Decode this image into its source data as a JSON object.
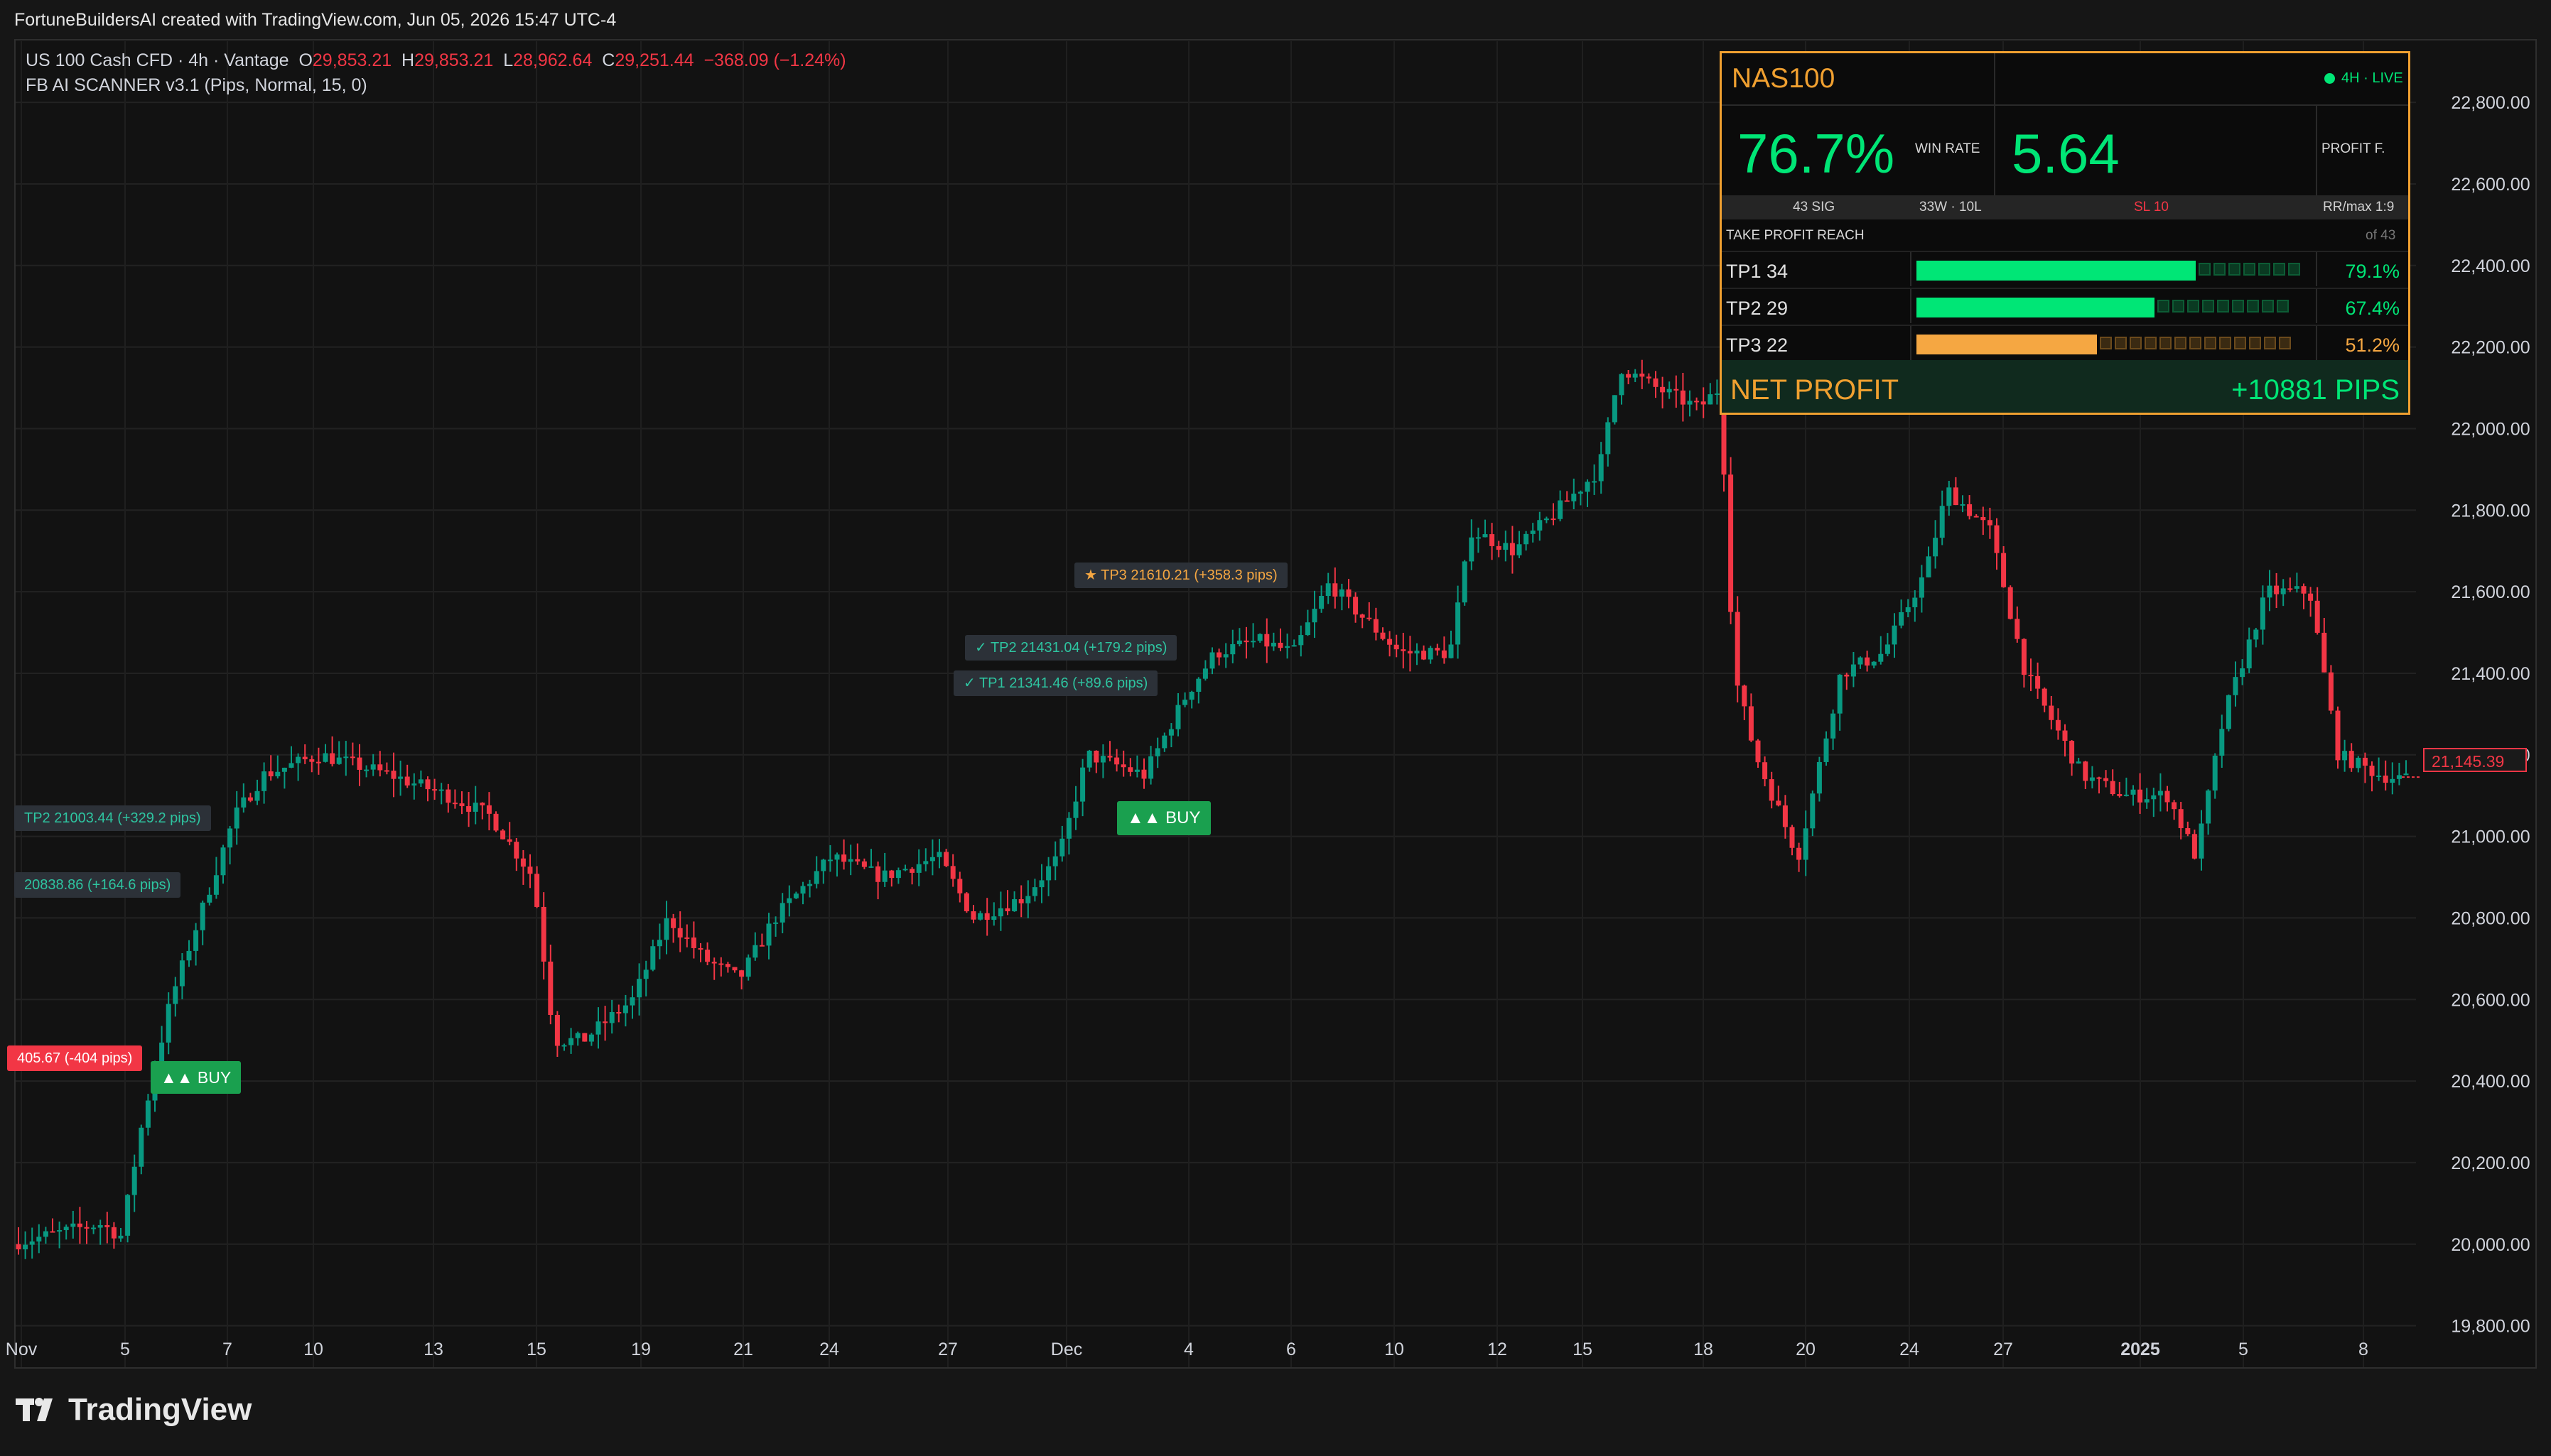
{
  "header": {
    "attribution": "FortuneBuildersAI created with TradingView.com, Jun 05, 2026 15:47 UTC-4"
  },
  "legend": {
    "symbol": "US 100 Cash CFD · 4h · Vantage",
    "o_label": "O",
    "o_value": "29,853.21",
    "h_label": "H",
    "h_value": "29,853.21",
    "l_label": "L",
    "l_value": "28,962.64",
    "c_label": "C",
    "c_value": "29,251.44",
    "change": "−368.09 (−1.24%)",
    "indicator": "FB AI SCANNER v3.1 (Pips, Normal, 15, 0)"
  },
  "price_axis": {
    "ticks": [
      "22,800.00",
      "22,600.00",
      "22,400.00",
      "22,200.00",
      "22,000.00",
      "21,800.00",
      "21,600.00",
      "21,400.00",
      "21,200.00",
      "21,000.00",
      "20,800.00",
      "20,600.00",
      "20,400.00",
      "20,200.00",
      "20,000.00",
      "19,800.00"
    ],
    "current_price": "21,145.39"
  },
  "time_axis": {
    "labels": [
      "Nov",
      "5",
      "7",
      "10",
      "13",
      "15",
      "19",
      "21",
      "24",
      "27",
      "Dec",
      "4",
      "6",
      "10",
      "12",
      "15",
      "18",
      "20",
      "24",
      "27",
      "2025",
      "5",
      "8"
    ]
  },
  "annotations": {
    "tp2_left": "TP2  21003.44  (+329.2 pips)",
    "tp1_left": "20838.86  (+164.6 pips)",
    "sl_left": "405.67  (-404 pips)",
    "buy_left": "▲▲ BUY",
    "tp3_mid": "★ TP3  21610.21  (+358.3 pips)",
    "tp2_mid": "✓ TP2  21431.04  (+179.2 pips)",
    "tp1_mid": "✓ TP1  21341.46  (+89.6 pips)",
    "buy_mid": "▲▲ BUY"
  },
  "dashboard": {
    "symbol": "NAS100",
    "live": "4H · LIVE",
    "win_rate_value": "76.7%",
    "win_rate_label": "WIN RATE",
    "profit_factor_value": "5.64",
    "profit_factor_label": "PROFIT F.",
    "signals": "43 SIG",
    "record": "33W · 10L",
    "sl": "SL  10",
    "rr": "RR/max  1:9",
    "tp_reach_label": "TAKE PROFIT REACH",
    "of_total": "of 43",
    "tp_rows": [
      {
        "label": "TP1  34",
        "pct": "79.1%",
        "fraction": 0.791,
        "color": "#00e676"
      },
      {
        "label": "TP2  29",
        "pct": "67.4%",
        "fraction": 0.674,
        "color": "#00e676"
      },
      {
        "label": "TP3  22",
        "pct": "51.2%",
        "fraction": 0.512,
        "color": "#f5a742"
      }
    ],
    "net_profit_label": "NET PROFIT",
    "net_profit_value": "+10881 PIPS"
  },
  "brand": {
    "logo_text": "TradingView"
  },
  "colors": {
    "bull": "#089981",
    "bear": "#f23645",
    "accent": "#f0a030",
    "live": "#00e676"
  }
}
